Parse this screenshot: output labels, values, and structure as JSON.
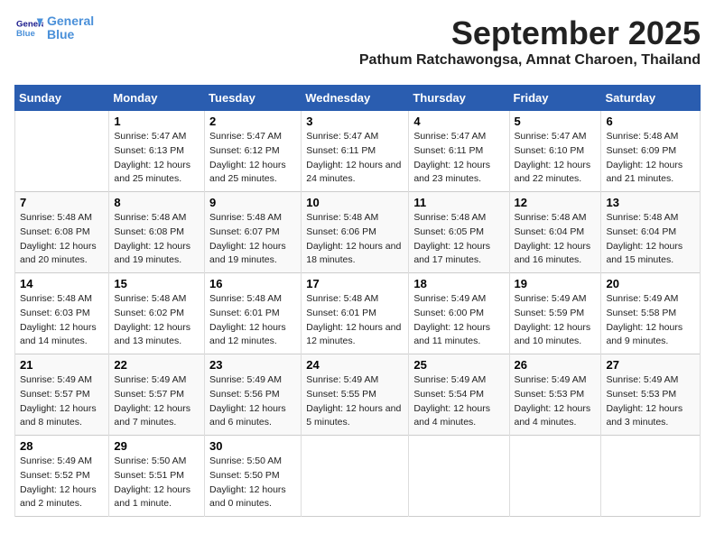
{
  "app": {
    "logo_line1": "General",
    "logo_line2": "Blue"
  },
  "header": {
    "month": "September 2025",
    "location": "Pathum Ratchawongsa, Amnat Charoen, Thailand"
  },
  "weekdays": [
    "Sunday",
    "Monday",
    "Tuesday",
    "Wednesday",
    "Thursday",
    "Friday",
    "Saturday"
  ],
  "weeks": [
    [
      {
        "day": "",
        "sunrise": "",
        "sunset": "",
        "daylight": ""
      },
      {
        "day": "1",
        "sunrise": "Sunrise: 5:47 AM",
        "sunset": "Sunset: 6:13 PM",
        "daylight": "Daylight: 12 hours and 25 minutes."
      },
      {
        "day": "2",
        "sunrise": "Sunrise: 5:47 AM",
        "sunset": "Sunset: 6:12 PM",
        "daylight": "Daylight: 12 hours and 25 minutes."
      },
      {
        "day": "3",
        "sunrise": "Sunrise: 5:47 AM",
        "sunset": "Sunset: 6:11 PM",
        "daylight": "Daylight: 12 hours and 24 minutes."
      },
      {
        "day": "4",
        "sunrise": "Sunrise: 5:47 AM",
        "sunset": "Sunset: 6:11 PM",
        "daylight": "Daylight: 12 hours and 23 minutes."
      },
      {
        "day": "5",
        "sunrise": "Sunrise: 5:47 AM",
        "sunset": "Sunset: 6:10 PM",
        "daylight": "Daylight: 12 hours and 22 minutes."
      },
      {
        "day": "6",
        "sunrise": "Sunrise: 5:48 AM",
        "sunset": "Sunset: 6:09 PM",
        "daylight": "Daylight: 12 hours and 21 minutes."
      }
    ],
    [
      {
        "day": "7",
        "sunrise": "Sunrise: 5:48 AM",
        "sunset": "Sunset: 6:08 PM",
        "daylight": "Daylight: 12 hours and 20 minutes."
      },
      {
        "day": "8",
        "sunrise": "Sunrise: 5:48 AM",
        "sunset": "Sunset: 6:08 PM",
        "daylight": "Daylight: 12 hours and 19 minutes."
      },
      {
        "day": "9",
        "sunrise": "Sunrise: 5:48 AM",
        "sunset": "Sunset: 6:07 PM",
        "daylight": "Daylight: 12 hours and 19 minutes."
      },
      {
        "day": "10",
        "sunrise": "Sunrise: 5:48 AM",
        "sunset": "Sunset: 6:06 PM",
        "daylight": "Daylight: 12 hours and 18 minutes."
      },
      {
        "day": "11",
        "sunrise": "Sunrise: 5:48 AM",
        "sunset": "Sunset: 6:05 PM",
        "daylight": "Daylight: 12 hours and 17 minutes."
      },
      {
        "day": "12",
        "sunrise": "Sunrise: 5:48 AM",
        "sunset": "Sunset: 6:04 PM",
        "daylight": "Daylight: 12 hours and 16 minutes."
      },
      {
        "day": "13",
        "sunrise": "Sunrise: 5:48 AM",
        "sunset": "Sunset: 6:04 PM",
        "daylight": "Daylight: 12 hours and 15 minutes."
      }
    ],
    [
      {
        "day": "14",
        "sunrise": "Sunrise: 5:48 AM",
        "sunset": "Sunset: 6:03 PM",
        "daylight": "Daylight: 12 hours and 14 minutes."
      },
      {
        "day": "15",
        "sunrise": "Sunrise: 5:48 AM",
        "sunset": "Sunset: 6:02 PM",
        "daylight": "Daylight: 12 hours and 13 minutes."
      },
      {
        "day": "16",
        "sunrise": "Sunrise: 5:48 AM",
        "sunset": "Sunset: 6:01 PM",
        "daylight": "Daylight: 12 hours and 12 minutes."
      },
      {
        "day": "17",
        "sunrise": "Sunrise: 5:48 AM",
        "sunset": "Sunset: 6:01 PM",
        "daylight": "Daylight: 12 hours and 12 minutes."
      },
      {
        "day": "18",
        "sunrise": "Sunrise: 5:49 AM",
        "sunset": "Sunset: 6:00 PM",
        "daylight": "Daylight: 12 hours and 11 minutes."
      },
      {
        "day": "19",
        "sunrise": "Sunrise: 5:49 AM",
        "sunset": "Sunset: 5:59 PM",
        "daylight": "Daylight: 12 hours and 10 minutes."
      },
      {
        "day": "20",
        "sunrise": "Sunrise: 5:49 AM",
        "sunset": "Sunset: 5:58 PM",
        "daylight": "Daylight: 12 hours and 9 minutes."
      }
    ],
    [
      {
        "day": "21",
        "sunrise": "Sunrise: 5:49 AM",
        "sunset": "Sunset: 5:57 PM",
        "daylight": "Daylight: 12 hours and 8 minutes."
      },
      {
        "day": "22",
        "sunrise": "Sunrise: 5:49 AM",
        "sunset": "Sunset: 5:57 PM",
        "daylight": "Daylight: 12 hours and 7 minutes."
      },
      {
        "day": "23",
        "sunrise": "Sunrise: 5:49 AM",
        "sunset": "Sunset: 5:56 PM",
        "daylight": "Daylight: 12 hours and 6 minutes."
      },
      {
        "day": "24",
        "sunrise": "Sunrise: 5:49 AM",
        "sunset": "Sunset: 5:55 PM",
        "daylight": "Daylight: 12 hours and 5 minutes."
      },
      {
        "day": "25",
        "sunrise": "Sunrise: 5:49 AM",
        "sunset": "Sunset: 5:54 PM",
        "daylight": "Daylight: 12 hours and 4 minutes."
      },
      {
        "day": "26",
        "sunrise": "Sunrise: 5:49 AM",
        "sunset": "Sunset: 5:53 PM",
        "daylight": "Daylight: 12 hours and 4 minutes."
      },
      {
        "day": "27",
        "sunrise": "Sunrise: 5:49 AM",
        "sunset": "Sunset: 5:53 PM",
        "daylight": "Daylight: 12 hours and 3 minutes."
      }
    ],
    [
      {
        "day": "28",
        "sunrise": "Sunrise: 5:49 AM",
        "sunset": "Sunset: 5:52 PM",
        "daylight": "Daylight: 12 hours and 2 minutes."
      },
      {
        "day": "29",
        "sunrise": "Sunrise: 5:50 AM",
        "sunset": "Sunset: 5:51 PM",
        "daylight": "Daylight: 12 hours and 1 minute."
      },
      {
        "day": "30",
        "sunrise": "Sunrise: 5:50 AM",
        "sunset": "Sunset: 5:50 PM",
        "daylight": "Daylight: 12 hours and 0 minutes."
      },
      {
        "day": "",
        "sunrise": "",
        "sunset": "",
        "daylight": ""
      },
      {
        "day": "",
        "sunrise": "",
        "sunset": "",
        "daylight": ""
      },
      {
        "day": "",
        "sunrise": "",
        "sunset": "",
        "daylight": ""
      },
      {
        "day": "",
        "sunrise": "",
        "sunset": "",
        "daylight": ""
      }
    ]
  ]
}
